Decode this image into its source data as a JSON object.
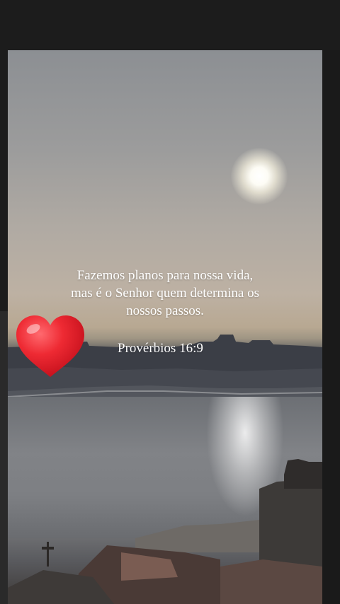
{
  "story": {
    "quote_lines": [
      "Fazemos planos para nossa vida,",
      "mas é o Senhor quem determina os",
      "nossos passos."
    ],
    "reference": "Provérbios 16:9",
    "sticker": "heart-icon"
  },
  "colors": {
    "background": "#1c1c1c",
    "heart": "#e8202c",
    "text": "#ffffff"
  }
}
